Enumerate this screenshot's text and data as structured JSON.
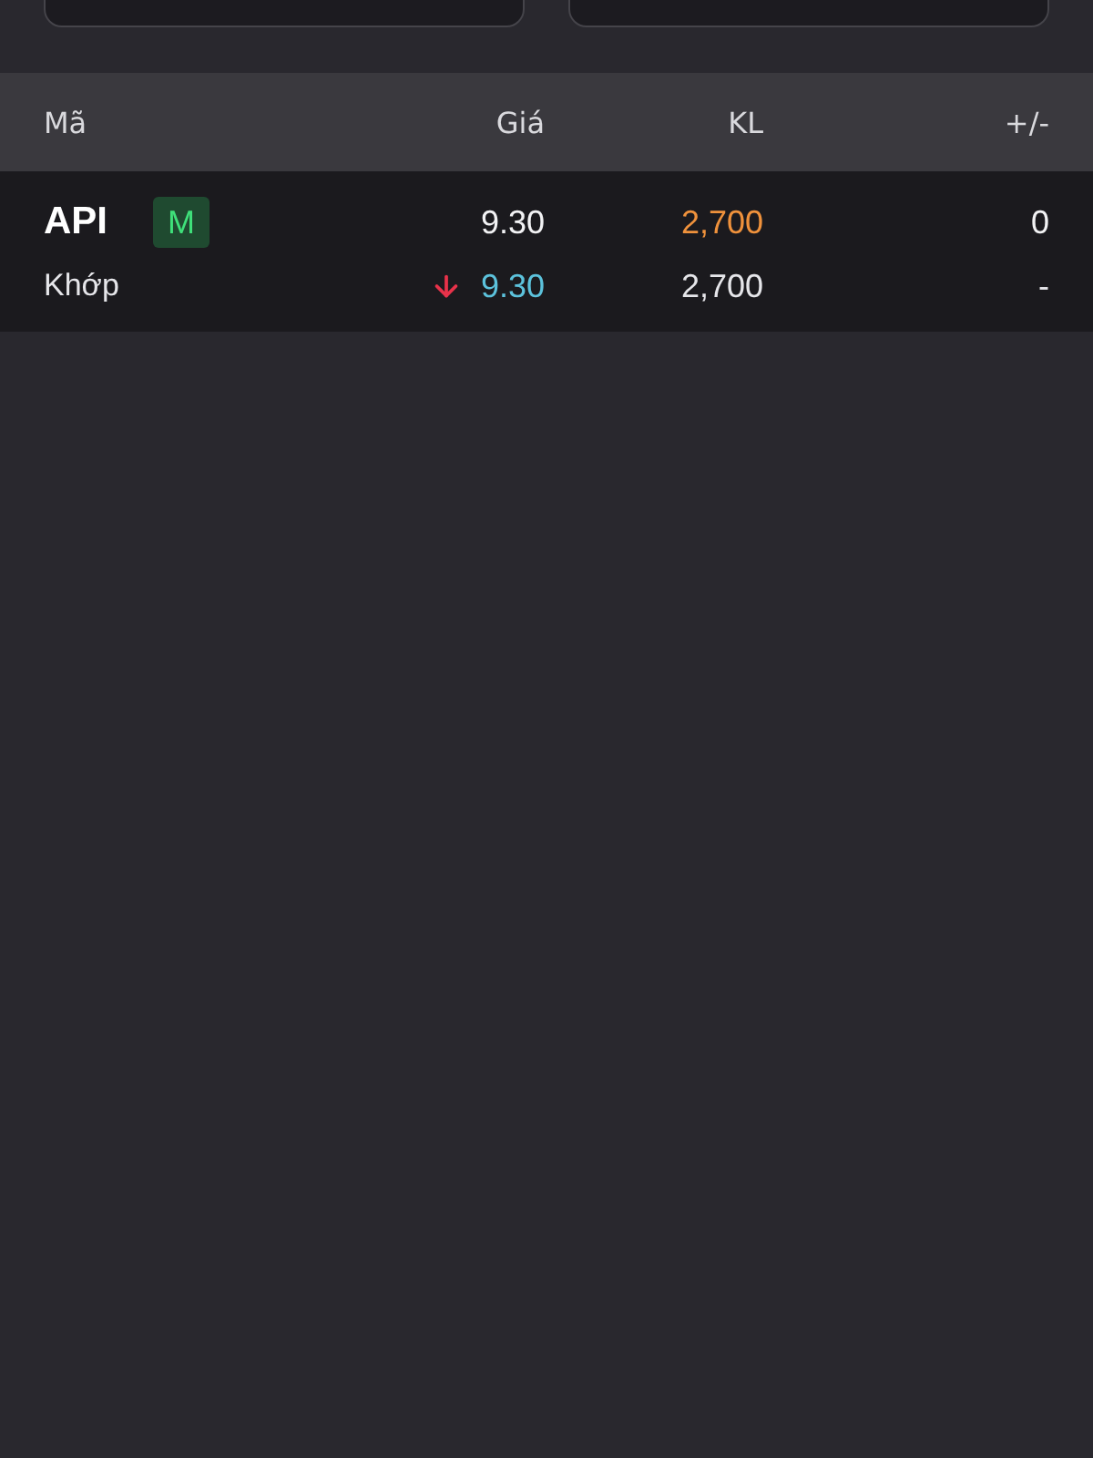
{
  "table": {
    "columns": [
      {
        "label": "Mã"
      },
      {
        "label": "Giá"
      },
      {
        "label": "KL"
      },
      {
        "label": "+/-"
      }
    ],
    "rows": [
      {
        "symbol": "API",
        "badge": "M",
        "price": "9.30",
        "volume": "2,700",
        "change": "0",
        "match_label": "Khớp",
        "match_falling": true,
        "match_price": "9.30",
        "match_volume": "2,700",
        "match_change": "-"
      }
    ]
  }
}
